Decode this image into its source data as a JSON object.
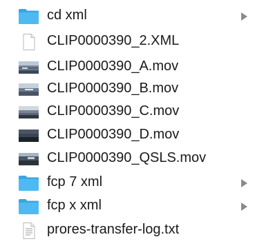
{
  "window": {
    "title": ""
  },
  "file_list": {
    "items": [
      {
        "name": "cd xml",
        "kind": "folder",
        "icon": "folder-icon",
        "expandable": true
      },
      {
        "name": "CLIP0000390_2.XML",
        "kind": "document",
        "icon": "blank-document-icon",
        "expandable": false
      },
      {
        "name": "CLIP0000390_A.mov",
        "kind": "movie",
        "icon": "movie-thumbnail-icon",
        "expandable": false
      },
      {
        "name": "CLIP0000390_B.mov",
        "kind": "movie",
        "icon": "movie-thumbnail-icon",
        "expandable": false
      },
      {
        "name": "CLIP0000390_C.mov",
        "kind": "movie",
        "icon": "movie-thumbnail-icon",
        "expandable": false
      },
      {
        "name": "CLIP0000390_D.mov",
        "kind": "movie",
        "icon": "movie-thumbnail-icon",
        "expandable": false
      },
      {
        "name": "CLIP0000390_QSLS.mov",
        "kind": "movie",
        "icon": "movie-thumbnail-icon",
        "expandable": false
      },
      {
        "name": "fcp 7 xml",
        "kind": "folder",
        "icon": "folder-icon",
        "expandable": true
      },
      {
        "name": "fcp x xml",
        "kind": "folder",
        "icon": "folder-icon",
        "expandable": true
      },
      {
        "name": "prores-transfer-log.txt",
        "kind": "text",
        "icon": "text-document-icon",
        "expandable": false
      }
    ]
  },
  "colors": {
    "folder_body": "#4fb9f2",
    "folder_tab": "#3aa5e0",
    "text": "#1a1a1a",
    "chevron": "#8a8a8a",
    "doc_border": "#b8b8b8"
  }
}
